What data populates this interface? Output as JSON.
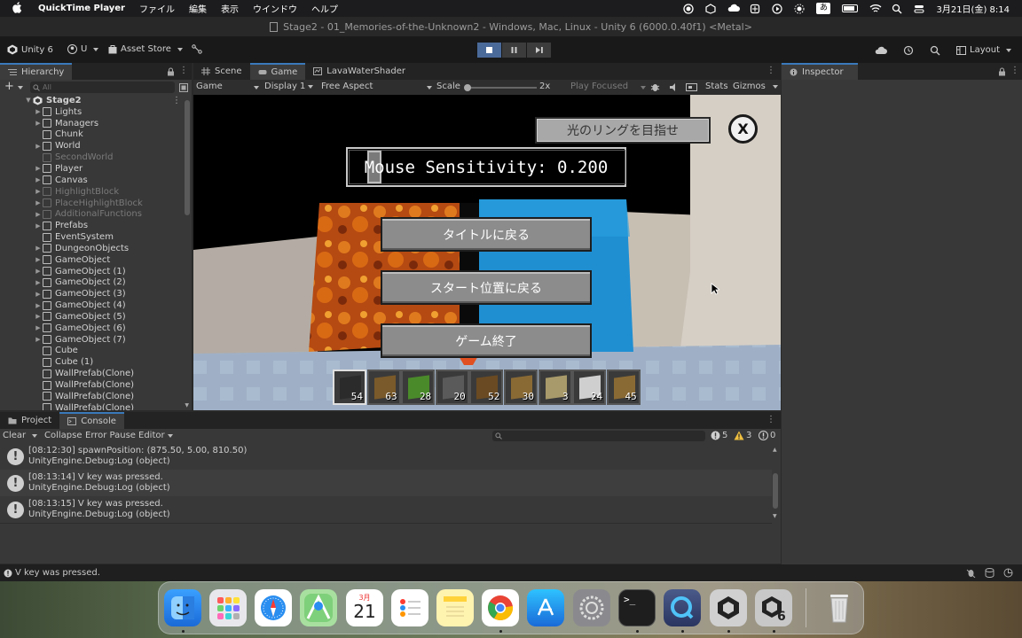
{
  "menubar": {
    "app": "QuickTime Player",
    "items": [
      "ファイル",
      "編集",
      "表示",
      "ウインドウ",
      "ヘルプ"
    ],
    "ime": "あ",
    "datetime": "3月21日(金)  8:14"
  },
  "window": {
    "title": "Stage2 - 01_Memories-of-the-Unknown2 - Windows, Mac, Linux - Unity 6 (6000.0.40f1) <Metal>"
  },
  "toolbar": {
    "unity": "Unity 6",
    "account": "U",
    "asset_store": "Asset Store",
    "layout": "Layout"
  },
  "hierarchy": {
    "tab": "Hierarchy",
    "search_placeholder": "All",
    "scene": "Stage2",
    "items": [
      {
        "label": "Lights",
        "dim": false,
        "arrow": true
      },
      {
        "label": "Managers",
        "dim": false,
        "arrow": true
      },
      {
        "label": "Chunk",
        "dim": false,
        "arrow": false
      },
      {
        "label": "World",
        "dim": false,
        "arrow": true
      },
      {
        "label": "SecondWorld",
        "dim": true,
        "arrow": false
      },
      {
        "label": "Player",
        "dim": false,
        "arrow": true
      },
      {
        "label": "Canvas",
        "dim": false,
        "arrow": true
      },
      {
        "label": "HighlightBlock",
        "dim": true,
        "arrow": true
      },
      {
        "label": "PlaceHighlightBlock",
        "dim": true,
        "arrow": true
      },
      {
        "label": "AdditionalFunctions",
        "dim": true,
        "arrow": true
      },
      {
        "label": "Prefabs",
        "dim": false,
        "arrow": true
      },
      {
        "label": "EventSystem",
        "dim": false,
        "arrow": false
      },
      {
        "label": "DungeonObjects",
        "dim": false,
        "arrow": true
      },
      {
        "label": "GameObject",
        "dim": false,
        "arrow": true
      },
      {
        "label": "GameObject (1)",
        "dim": false,
        "arrow": true
      },
      {
        "label": "GameObject (2)",
        "dim": false,
        "arrow": true
      },
      {
        "label": "GameObject (3)",
        "dim": false,
        "arrow": true
      },
      {
        "label": "GameObject (4)",
        "dim": false,
        "arrow": true
      },
      {
        "label": "GameObject (5)",
        "dim": false,
        "arrow": true
      },
      {
        "label": "GameObject (6)",
        "dim": false,
        "arrow": true
      },
      {
        "label": "GameObject (7)",
        "dim": false,
        "arrow": true
      },
      {
        "label": "Cube",
        "dim": false,
        "arrow": false
      },
      {
        "label": "Cube (1)",
        "dim": false,
        "arrow": false
      },
      {
        "label": "WallPrefab(Clone)",
        "dim": false,
        "arrow": false
      },
      {
        "label": "WallPrefab(Clone)",
        "dim": false,
        "arrow": false
      },
      {
        "label": "WallPrefab(Clone)",
        "dim": false,
        "arrow": false
      },
      {
        "label": "WallPrefab(Clone)",
        "dim": false,
        "arrow": false
      }
    ]
  },
  "tabs": {
    "scene": "Scene",
    "game": "Game",
    "shader": "LavaWaterShader",
    "inspector": "Inspector"
  },
  "game_toolbar": {
    "mode": "Game",
    "display": "Display 1",
    "aspect": "Free Aspect",
    "scale_label": "Scale",
    "scale_value": "2x",
    "play_mode": "Play Focused",
    "stats": "Stats",
    "gizmos": "Gizmos"
  },
  "game": {
    "hint_button": "光のリングを目指せ",
    "close_button": "X",
    "sensitivity_label": "Mouse Sensitivity: 0.200",
    "sensitivity_value": 0.2,
    "menu": [
      "タイトルに戻る",
      "スタート位置に戻る",
      "ゲーム終了"
    ],
    "hotbar": [
      "54",
      "63",
      "28",
      "20",
      "52",
      "30",
      "3",
      "24",
      "45"
    ]
  },
  "bottom_tabs": {
    "project": "Project",
    "console": "Console"
  },
  "console": {
    "clear": "Clear",
    "collapse": "Collapse",
    "error_pause": "Error Pause",
    "editor": "Editor",
    "count_log": "5",
    "count_warn": "3",
    "count_err": "0",
    "logs": [
      {
        "line1": "[08:12:30] spawnPosition: (875.50, 5.00, 810.50)",
        "line2": "UnityEngine.Debug:Log (object)"
      },
      {
        "line1": "[08:13:14] V key was pressed.",
        "line2": "UnityEngine.Debug:Log (object)"
      },
      {
        "line1": "[08:13:15] V key was pressed.",
        "line2": "UnityEngine.Debug:Log (object)"
      }
    ]
  },
  "status": {
    "message": "V key was pressed."
  },
  "dock": {
    "calendar_month": "3月",
    "calendar_day": "21"
  }
}
